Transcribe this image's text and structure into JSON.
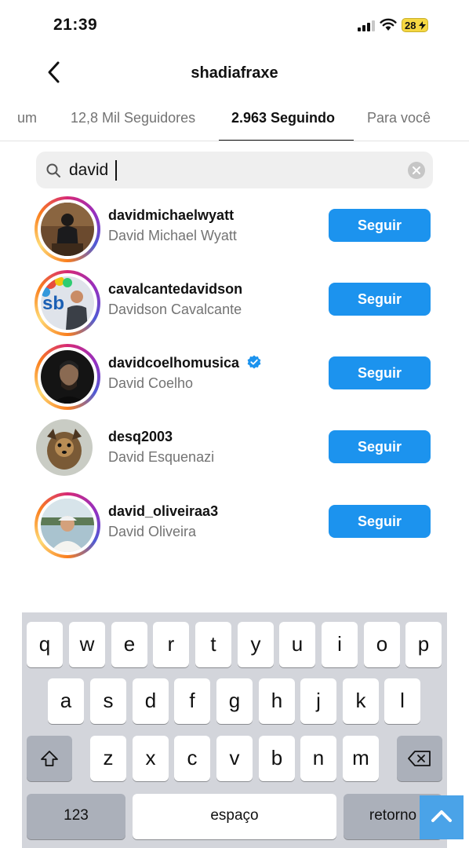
{
  "status_bar": {
    "time": "21:39",
    "battery": "28"
  },
  "header": {
    "title": "shadiafraxe"
  },
  "tabs": [
    {
      "label": "um"
    },
    {
      "label": "12,8 Mil Seguidores"
    },
    {
      "label": "2.963 Seguindo"
    },
    {
      "label": "Para você"
    }
  ],
  "search": {
    "value": "david"
  },
  "users": [
    {
      "username": "davidmichaelwyatt",
      "name": "David Michael Wyatt",
      "button": "Seguir"
    },
    {
      "username": "cavalcantedavidson",
      "name": "Davidson Cavalcante",
      "button": "Seguir"
    },
    {
      "username": "davidcoelhomusica",
      "name": "David Coelho",
      "button": "Seguir",
      "verified": true
    },
    {
      "username": "desq2003",
      "name": "David Esquenazi",
      "button": "Seguir"
    },
    {
      "username": "david_oliveiraa3",
      "name": "David Oliveira",
      "button": "Seguir"
    }
  ],
  "keyboard": {
    "row1": [
      "q",
      "w",
      "e",
      "r",
      "t",
      "y",
      "u",
      "i",
      "o",
      "p"
    ],
    "row2": [
      "a",
      "s",
      "d",
      "f",
      "g",
      "h",
      "j",
      "k",
      "l"
    ],
    "row3": [
      "z",
      "x",
      "c",
      "v",
      "b",
      "n",
      "m"
    ],
    "numbers": "123",
    "space": "espaço",
    "return": "retorno"
  },
  "colors": {
    "accent": "#1c93ee",
    "keyboard_bg": "#d3d5db",
    "scroll_button": "#4aa3e8"
  },
  "icons": [
    "back-arrow-icon",
    "search-icon",
    "clear-icon",
    "verified-icon",
    "shift-icon",
    "backspace-icon",
    "chevron-up-icon"
  ]
}
